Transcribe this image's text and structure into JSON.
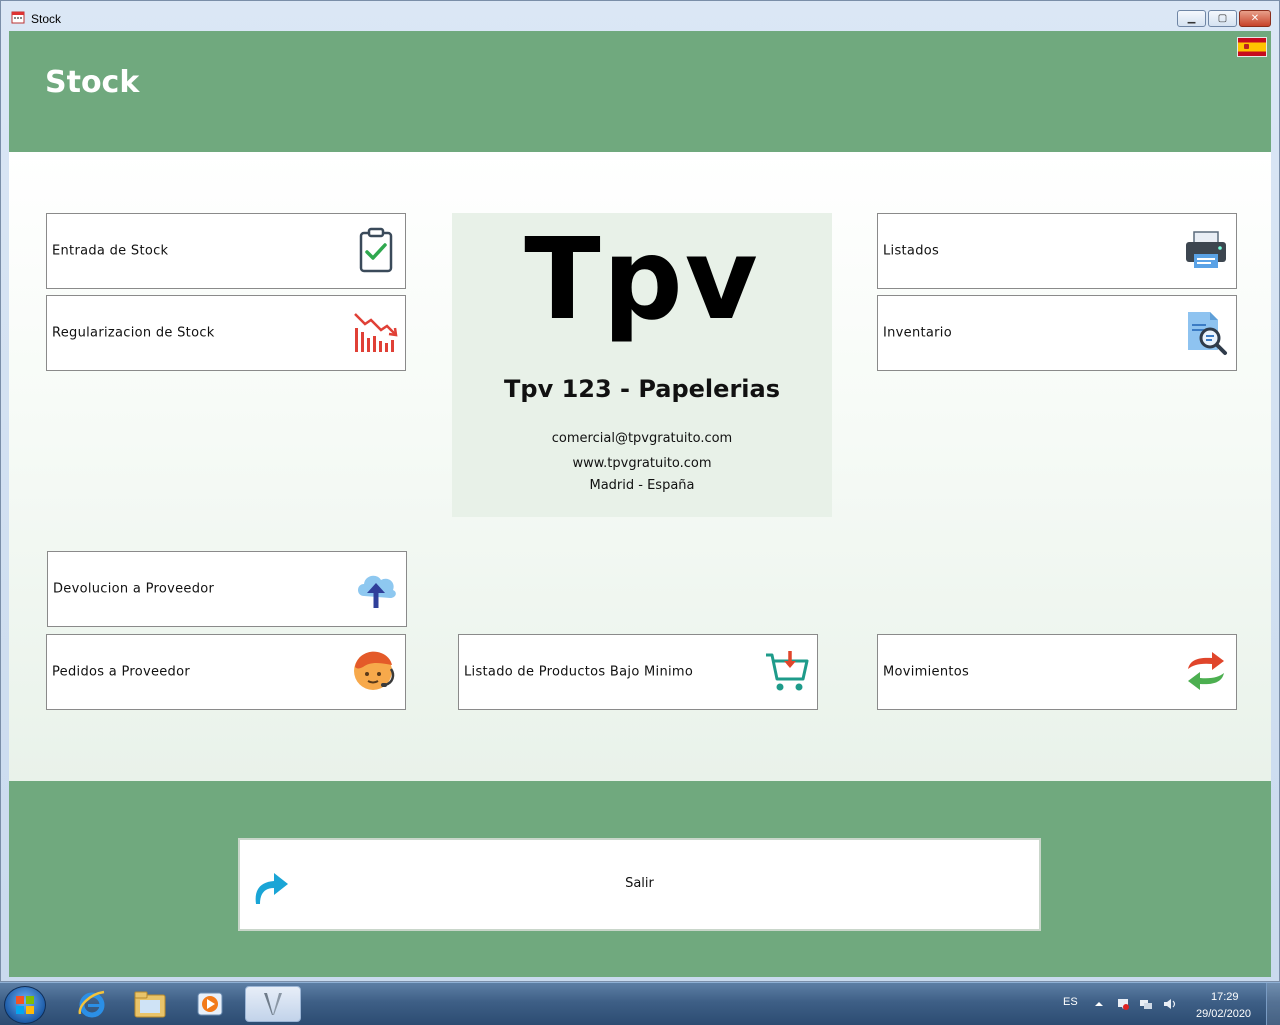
{
  "window": {
    "title": "Stock",
    "controls": {
      "minimize": "▁",
      "maximize": "▢",
      "close": "✕"
    }
  },
  "header": {
    "title": "Stock",
    "language_flag": "spain-flag-icon"
  },
  "tiles": {
    "entrada": {
      "label": "Entrada de Stock",
      "icon": "clipboard-check-icon"
    },
    "regularizacion": {
      "label": "Regularizacion de Stock",
      "icon": "declining-chart-icon"
    },
    "listados": {
      "label": "Listados",
      "icon": "printer-icon"
    },
    "inventario": {
      "label": "Inventario",
      "icon": "document-search-icon"
    },
    "devolucion": {
      "label": "Devolucion a Proveedor",
      "icon": "cloud-upload-icon"
    },
    "pedidos": {
      "label": "Pedidos a Proveedor",
      "icon": "support-agent-icon"
    },
    "bajo_minimo": {
      "label": "Listado de Productos Bajo Minimo",
      "icon": "cart-download-icon"
    },
    "movimientos": {
      "label": "Movimientos",
      "icon": "sync-arrows-icon"
    }
  },
  "info": {
    "logo": "Tpv",
    "product": "Tpv 123 - Papelerias",
    "email": "comercial@tpvgratuito.com",
    "web": "www.tpvgratuito.com",
    "location": "Madrid - España"
  },
  "footer": {
    "exit_label": "Salir",
    "exit_icon": "redo-arrow-icon"
  },
  "taskbar": {
    "language": "ES",
    "time": "17:29",
    "date": "29/02/2020",
    "apps": [
      "internet-explorer-icon",
      "file-explorer-icon",
      "media-player-icon",
      "tpv-app-icon"
    ]
  },
  "colors": {
    "accent_green": "#70a97e",
    "panel_green": "#e8f1e8"
  }
}
